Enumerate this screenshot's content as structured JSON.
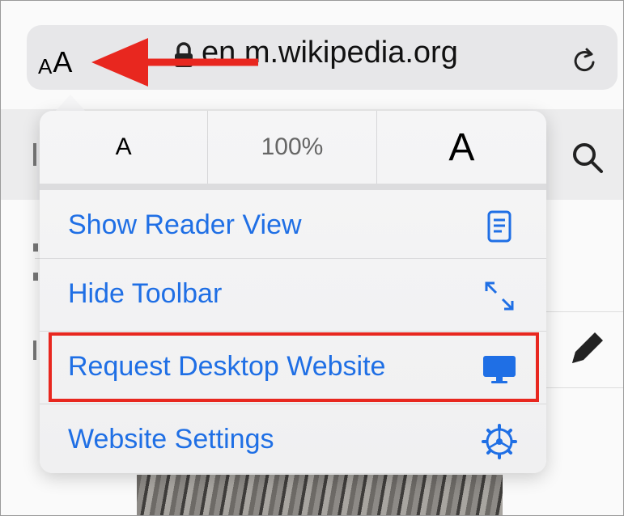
{
  "address_bar": {
    "text_size_button": {
      "small": "A",
      "large": "A"
    },
    "url": "en.m.wikipedia.org",
    "lock_icon": "lock-icon",
    "reload_icon": "reload-icon"
  },
  "font_controls": {
    "decrease_label": "A",
    "zoom_level": "100%",
    "increase_label": "A"
  },
  "menu": {
    "items": [
      {
        "label": "Show Reader View",
        "icon": "reader-view-icon"
      },
      {
        "label": "Hide Toolbar",
        "icon": "expand-arrows-icon"
      },
      {
        "label": "Request Desktop Website",
        "icon": "desktop-monitor-icon"
      },
      {
        "label": "Website Settings",
        "icon": "settings-gear-icon"
      }
    ]
  },
  "colors": {
    "accent": "#1f6fe5",
    "annotation_red": "#e8271f",
    "menu_background": "#f3f3f4",
    "address_bar_background": "#e7e7e9"
  }
}
